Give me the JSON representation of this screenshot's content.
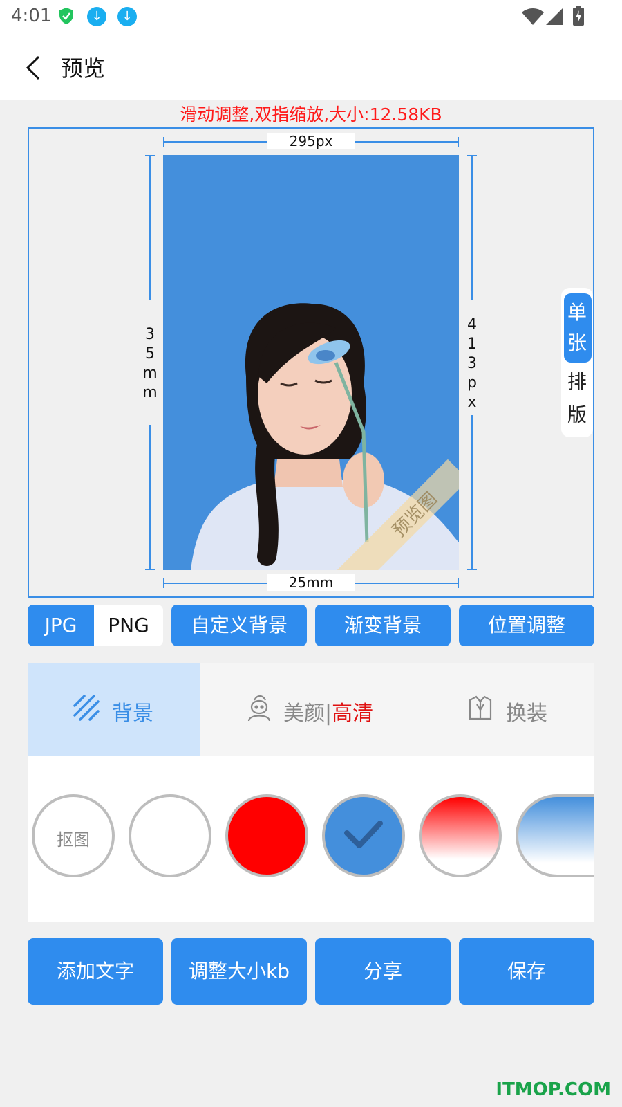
{
  "status_bar": {
    "time": "4:01"
  },
  "header": {
    "title": "预览"
  },
  "hint": "滑动调整,双指缩放,大小:12.58KB",
  "dimensions": {
    "top_px": "295px",
    "bottom_mm": "25mm",
    "left_mm": "35mm",
    "right_px": "413px"
  },
  "preview_watermark": "预览图",
  "side_toggle": {
    "single": "单张",
    "layout": "排版"
  },
  "format": {
    "jpg": "JPG",
    "png": "PNG",
    "selected": "JPG"
  },
  "options": {
    "custom_bg": "自定义背景",
    "gradient_bg": "渐变背景",
    "position": "位置调整"
  },
  "tabs": {
    "background": "背景",
    "beauty": "美颜",
    "separator": "|",
    "hd": "高清",
    "outfit": "换装"
  },
  "swatches": {
    "cutout_label": "抠图",
    "colors": [
      "#ffffff",
      "#ff0000",
      "#448fdc",
      "red-gradient",
      "blue-gradient"
    ],
    "selected": "#448fdc"
  },
  "actions": {
    "add_text": "添加文字",
    "resize_kb": "调整大小kb",
    "share": "分享",
    "save": "保存"
  },
  "site_watermark": "ITMOP.COM"
}
